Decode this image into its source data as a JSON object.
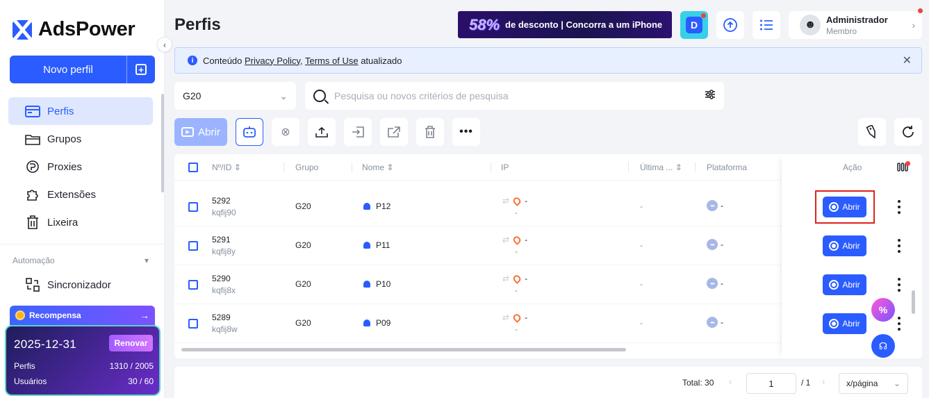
{
  "brand": {
    "name": "AdsPower"
  },
  "sidebar": {
    "new_profile": "Novo perfil",
    "items": [
      {
        "label": "Perfis",
        "icon": "window-icon"
      },
      {
        "label": "Grupos",
        "icon": "folder-icon"
      },
      {
        "label": "Proxies",
        "icon": "proxy-icon"
      },
      {
        "label": "Extensões",
        "icon": "puzzle-icon"
      },
      {
        "label": "Lixeira",
        "icon": "trash-icon"
      }
    ],
    "section": "Automação",
    "sync": "Sincronizador",
    "reward": "Recompensa",
    "plan": {
      "date": "2025-12-31",
      "renew": "Renovar",
      "profiles_label": "Perfis",
      "profiles_value": "1310 / 2005",
      "users_label": "Usuários",
      "users_value": "30 / 60"
    }
  },
  "header": {
    "title": "Perfis",
    "promo_pct": "58%",
    "promo_text": "de desconto | Concorra a um iPhone",
    "user_name": "Administrador",
    "user_role": "Membro"
  },
  "notice": {
    "prefix": "Conteúdo",
    "link1": "Privacy Policy",
    "comma": ",",
    "link2": "Terms of Use",
    "suffix": "atualizado"
  },
  "filters": {
    "group": "G20",
    "search_placeholder": "Pesquisa ou novos critérios de pesquisa"
  },
  "toolbar": {
    "open": "Abrir"
  },
  "table": {
    "headers": {
      "id": "Nº/ID",
      "group": "Grupo",
      "name": "Nome",
      "ip": "IP",
      "last": "Última ...",
      "platform": "Plataforma",
      "action": "Ação"
    },
    "rows": [
      {
        "no": "5292",
        "id": "kqfij90",
        "group": "G20",
        "name": "P12",
        "ip": "-",
        "ip2": "-",
        "last": "-",
        "platform": "-",
        "action": "Abrir"
      },
      {
        "no": "5291",
        "id": "kqfij8y",
        "group": "G20",
        "name": "P11",
        "ip": "-",
        "ip2": "-",
        "last": "-",
        "platform": "-",
        "action": "Abrir"
      },
      {
        "no": "5290",
        "id": "kqfij8x",
        "group": "G20",
        "name": "P10",
        "ip": "-",
        "ip2": "-",
        "last": "-",
        "platform": "-",
        "action": "Abrir"
      },
      {
        "no": "5289",
        "id": "kqfij8w",
        "group": "G20",
        "name": "P09",
        "ip": "-",
        "ip2": "-",
        "last": "-",
        "platform": "-",
        "action": "Abrir"
      }
    ]
  },
  "footer": {
    "total": "Total: 30",
    "page": "1",
    "of": "/ 1",
    "per_page": "x/página"
  }
}
